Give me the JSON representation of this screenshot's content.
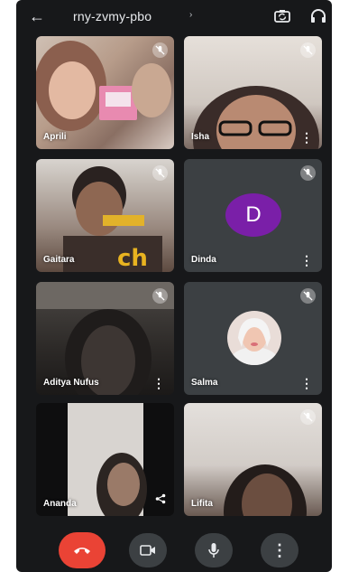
{
  "header": {
    "meeting_code": "rny-zvmy-pbo",
    "chevron": "›",
    "back_icon": "arrow-left-icon",
    "switch_camera_icon": "switch-camera-icon",
    "audio_icon": "headphones-icon"
  },
  "participants": [
    {
      "name": "Aprili",
      "muted": true
    },
    {
      "name": "Isha",
      "muted": true
    },
    {
      "name": "Gaitara",
      "muted": true
    },
    {
      "name": "Dinda",
      "muted": true,
      "avatar_letter": "D",
      "avatar_color": "#7a1fa8"
    },
    {
      "name": "Aditya Nufus",
      "muted": true
    },
    {
      "name": "Salma",
      "muted": true
    },
    {
      "name": "Ananda",
      "muted": false
    },
    {
      "name": "Lifita",
      "muted": true
    }
  ],
  "controls": {
    "end_call_icon": "phone-hangup-icon",
    "end_call_color": "#ea4335",
    "camera_icon": "video-camera-icon",
    "mic_icon": "microphone-icon",
    "more_icon": "more-vertical-icon"
  }
}
